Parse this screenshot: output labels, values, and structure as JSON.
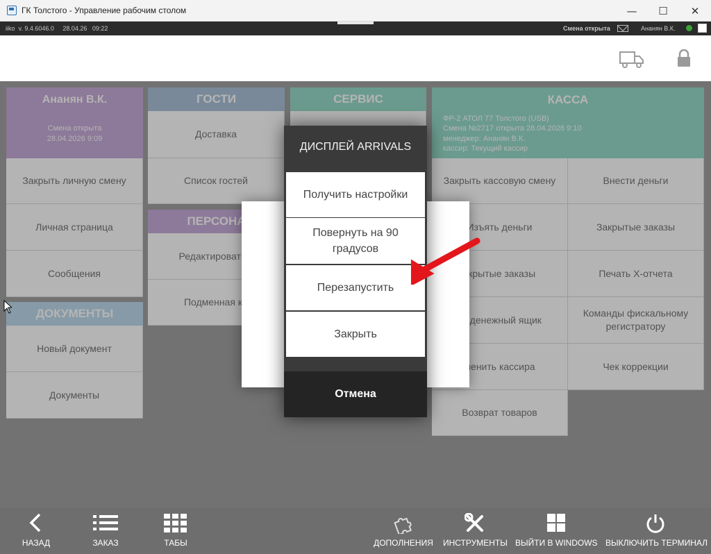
{
  "window": {
    "title": "ГК Толстого - Управление рабочим столом",
    "minimize": "—",
    "maximize": "☐",
    "close": "✕"
  },
  "statusbar": {
    "version": "iiko  v. 9.4.6046.0     28.04.26   09:22",
    "shift_status": "Смена открыта",
    "user": "Ананян В.К."
  },
  "user_panel": {
    "name": "Ананян В.К.",
    "shift": "Смена открыта",
    "shift_date": "28.04.2026 9:09",
    "items": [
      "Закрыть личную смену",
      "Личная страница",
      "Сообщения"
    ]
  },
  "documents": {
    "title": "ДОКУМЕНТЫ",
    "items": [
      "Новый документ",
      "Документы"
    ]
  },
  "guests": {
    "title": "ГОСТИ",
    "items": [
      "Доставка",
      "Список гостей"
    ]
  },
  "personnel": {
    "title": "ПЕРСОНА",
    "items": [
      "Редактировать з",
      "Подменная ка"
    ]
  },
  "service": {
    "title": "СЕРВИС"
  },
  "kassa": {
    "title": "КАССА",
    "info": [
      "ФР-2 АТОЛ 77 Толстого (USB)",
      "Смена №2717 открыта 28.04.2026 9:10",
      "менеджер: Ананян В.К.",
      "кассир: Текущий кассир"
    ],
    "left_items": [
      "Закрыть кассовую смену",
      "Изъять деньги",
      "ткрытые заказы",
      "ть денежный ящик",
      "менить кассира",
      "Возврат товаров"
    ],
    "right_items": [
      "Внести деньги",
      "Закрытые заказы",
      "Печать Х-отчета",
      "Команды фискальному регистратору",
      "Чек коррекции"
    ]
  },
  "dialog": {
    "title": "ДИСПЛЕЙ ARRIVALS",
    "buttons": [
      "Получить настройки",
      "Повернуть на 90 градусов",
      "Перезапустить",
      "Закрыть"
    ],
    "cancel": "Отмена"
  },
  "bottombar": {
    "back": "НАЗАД",
    "order": "ЗАКАЗ",
    "tabs": "ТАБЫ",
    "addons": "ДОПОЛНЕНИЯ",
    "tools": "ИНСТРУМЕНТЫ",
    "exit_windows": "ВЫЙТИ В WINDOWS",
    "shutdown": "ВЫКЛЮЧИТЬ ТЕРМИНАЛ"
  },
  "colors": {
    "user_header": "#c3a5d6",
    "guests_header": "#a5bdd6",
    "service_header": "#8fd9c5",
    "kassa_header": "#8fd9c5",
    "documents_header": "#b9d8ec",
    "arrow": "#e3161b"
  }
}
